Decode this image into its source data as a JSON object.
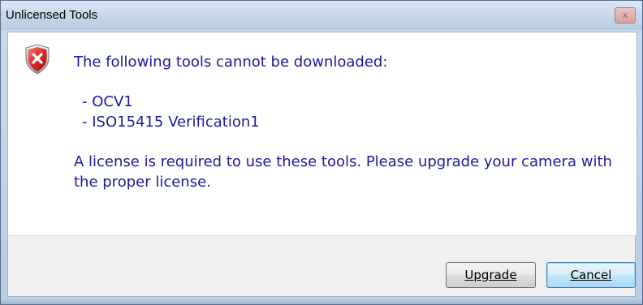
{
  "window": {
    "title": "Unlicensed Tools",
    "close_glyph": "x"
  },
  "message": {
    "icon": "error-shield-icon",
    "heading": "The following tools cannot be downloaded:",
    "tools": [
      "- OCV1",
      "- ISO15415 Verification1"
    ],
    "notice": "A license is required to use these tools. Please upgrade your camera with the proper license."
  },
  "buttons": {
    "upgrade_label": "Upgrade",
    "cancel_label": "Cancel"
  },
  "colors": {
    "message_text": "#1a1a9e",
    "error_red": "#d92b2b",
    "default_button_border": "#3c7fb1"
  }
}
